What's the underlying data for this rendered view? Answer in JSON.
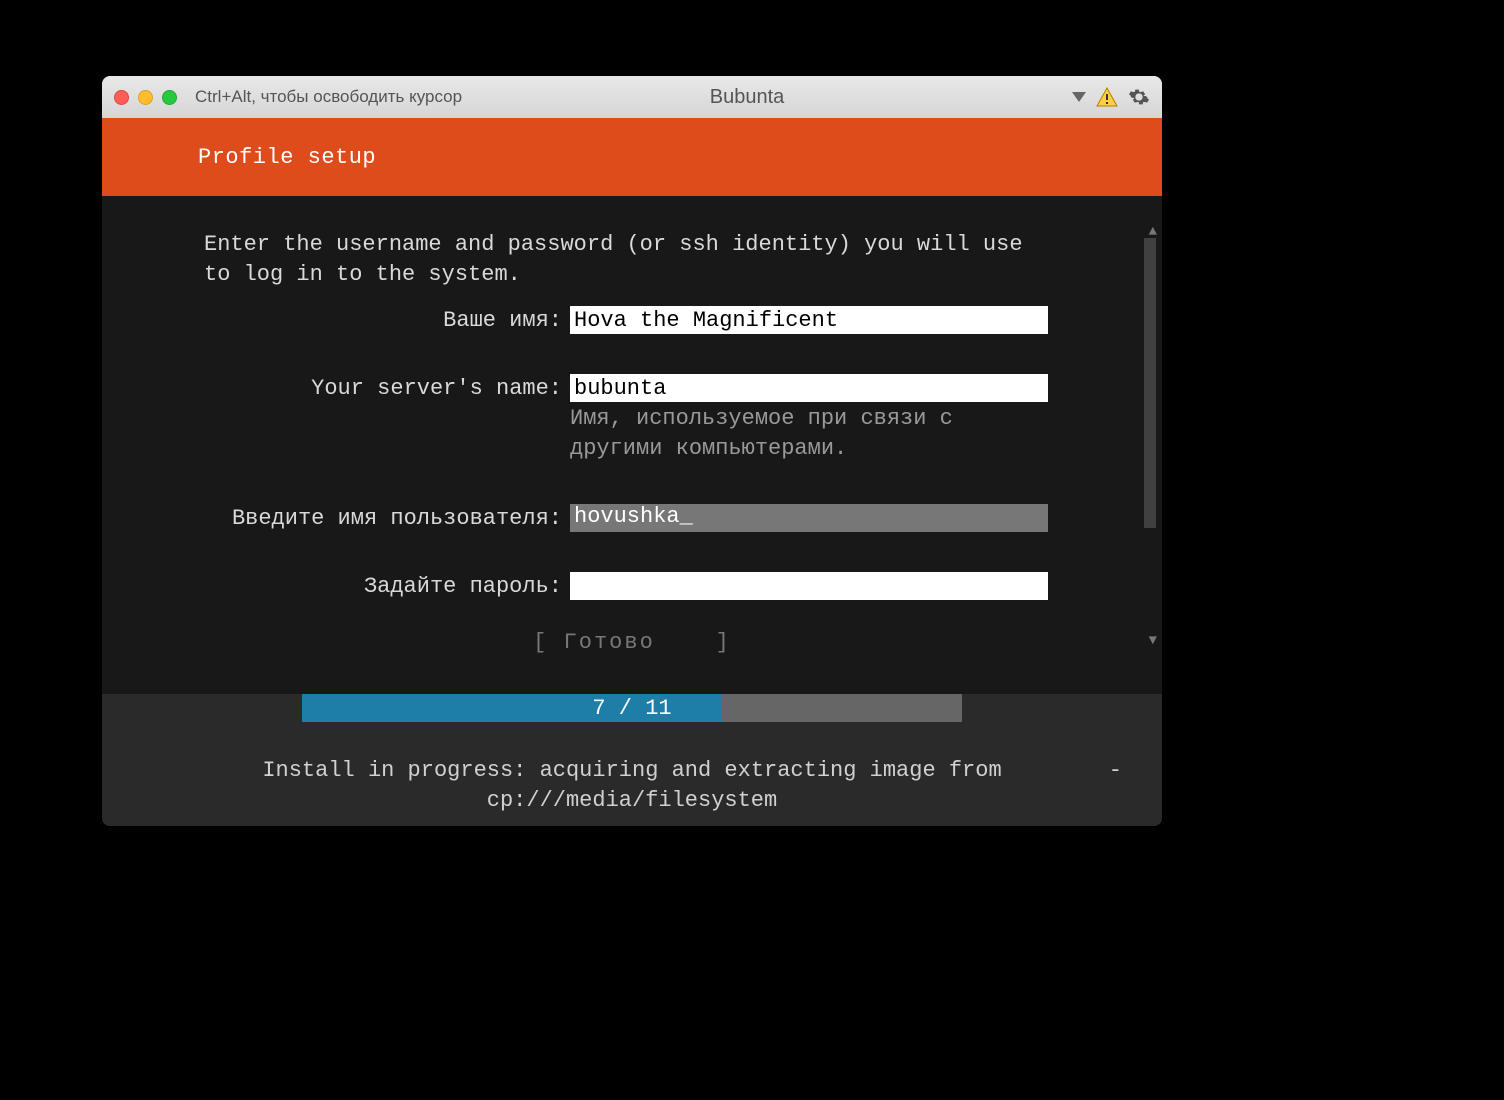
{
  "window": {
    "release_hint": "Ctrl+Alt, чтобы освободить курсор",
    "vm_name": "Bubunta"
  },
  "header": {
    "title": "Profile setup"
  },
  "instruction": "Enter the username and password (or ssh identity) you will use\nto log in to the system.",
  "form": {
    "name": {
      "label": "Ваше имя:",
      "value": "Hova the Magnificent"
    },
    "server": {
      "label": "Your server's name:",
      "value": "bubunta",
      "hint": "Имя, используемое при связи с\nдругими компьютерами."
    },
    "username": {
      "label": "Введите имя пользователя:",
      "value": "hovushka"
    },
    "password": {
      "label": "Задайте пароль:",
      "value": ""
    },
    "done_button": "Готово"
  },
  "progress": {
    "current": 7,
    "total": 11,
    "text": "7 / 11"
  },
  "status": {
    "prefix": "Install in progress: ",
    "msg": "acquiring and extracting image from",
    "path": "cp:///media/filesystem",
    "spinner": "-"
  }
}
